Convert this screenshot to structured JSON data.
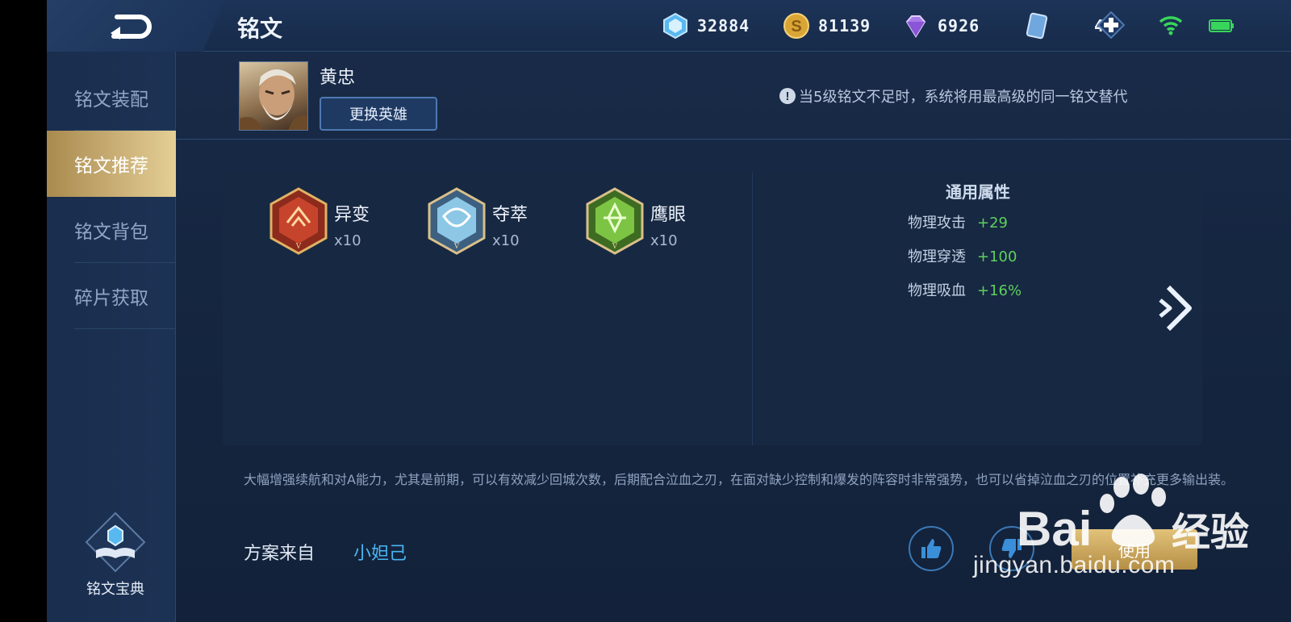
{
  "header": {
    "title": "铭文",
    "resources": [
      {
        "icon": "crystal-icon",
        "value": "32884"
      },
      {
        "icon": "gold-coin-icon",
        "value": "81139"
      },
      {
        "icon": "diamond-icon",
        "value": "6926"
      },
      {
        "icon": "card-icon",
        "value": "45"
      }
    ]
  },
  "sidebar": {
    "items": [
      {
        "label": "铭文装配",
        "active": false
      },
      {
        "label": "铭文推荐",
        "active": true
      },
      {
        "label": "铭文背包",
        "active": false
      },
      {
        "label": "碎片获取",
        "active": false
      }
    ],
    "codex_label": "铭文宝典"
  },
  "hero": {
    "name": "黄忠",
    "change_label": "更换英雄"
  },
  "notice": "当5级铭文不足时，系统将用最高级的同一铭文替代",
  "runes": [
    {
      "name": "异变",
      "count": "x10",
      "color": "#c0392b"
    },
    {
      "name": "夺萃",
      "count": "x10",
      "color": "#7ab6d8"
    },
    {
      "name": "鹰眼",
      "count": "x10",
      "color": "#6fbf3a"
    }
  ],
  "attributes": {
    "title": "通用属性",
    "rows": [
      {
        "name": "物理攻击",
        "value": "+29"
      },
      {
        "name": "物理穿透",
        "value": "+100"
      },
      {
        "name": "物理吸血",
        "value": "+16%"
      }
    ]
  },
  "description": "大幅增强续航和对A能力，尤其是前期，可以有效减少回城次数，后期配合泣血之刃，在面对缺少控制和爆发的阵容时非常强势，也可以省掉泣血之刃的位置补充更多输出装。",
  "source": {
    "label": "方案来自",
    "author": "小妲己"
  },
  "actions": {
    "use_label": "使用"
  },
  "watermark": {
    "brand": "Bai 经验",
    "url": "jingyan.baidu.com"
  },
  "colors": {
    "accent_gold": "#cdb37a",
    "positive_green": "#5ed05e",
    "link_blue": "#4ab6f2"
  }
}
